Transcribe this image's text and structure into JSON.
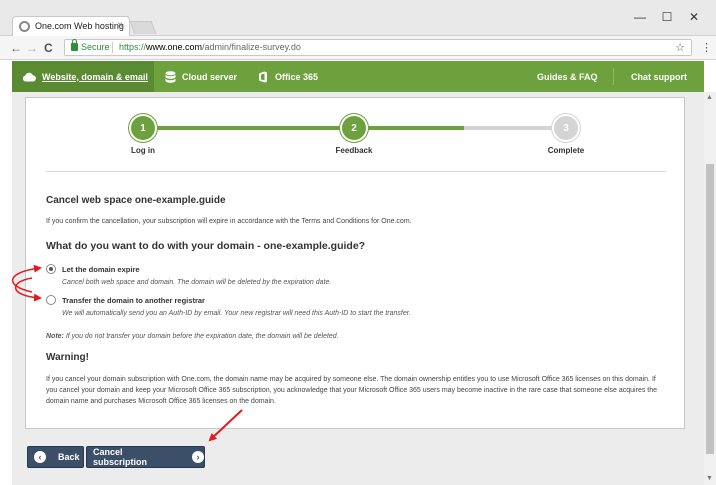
{
  "browser": {
    "tab_title": "One.com Web hosting",
    "tab_close": "×",
    "secure_label": "Secure",
    "url_scheme": "https://",
    "url_host": "www.one.com",
    "url_path": "/admin/finalize-survey.do",
    "window_controls": {
      "minimize": "—",
      "maximize": "☐",
      "close": "✕"
    },
    "nav": {
      "back": "←",
      "forward": "→",
      "reload": "C"
    },
    "star": "☆",
    "menu": "⋮"
  },
  "site_nav": {
    "website_domain_email": "Website, domain & email",
    "cloud_server": "Cloud server",
    "office_365": "Office 365",
    "guides_faq": "Guides & FAQ",
    "chat_support": "Chat support"
  },
  "steps": [
    {
      "number": "1",
      "label": "Log in",
      "state": "done"
    },
    {
      "number": "2",
      "label": "Feedback",
      "state": "current"
    },
    {
      "number": "3",
      "label": "Complete",
      "state": "pending"
    }
  ],
  "colors": {
    "accent_green": "#6da13e",
    "active_nav_green": "#5a8a31",
    "pending_grey": "#d4d4d4",
    "button_navy": "#3b5068",
    "annotation_red": "#e21b1b"
  },
  "cancel_heading": "Cancel web space one-example.guide",
  "cancel_text": "If you confirm the cancellation, your subscription will expire in accordance with the Terms and Conditions for One.com.",
  "domain_question": "What do you want to do with your domain - one-example.guide?",
  "options": [
    {
      "title": "Let the domain expire",
      "description": "Cancel both web space and domain. The domain will be deleted by the expiration date.",
      "selected": true
    },
    {
      "title": "Transfer the domain to another registrar",
      "description": "We will automatically send you an Auth-ID by email. Your new registrar will need this Auth-ID to start the transfer.",
      "selected": false
    }
  ],
  "note": {
    "label": "Note:",
    "text": "If you do not transfer your domain before the expiration date, the domain will be deleted."
  },
  "warning_heading": "Warning!",
  "warning_text": "If you cancel your domain subscription with One.com, the domain name may be acquired by someone else. The domain ownership entitles you to use Microsoft Office 365 licenses on this domain. If you cancel your domain and keep your Microsoft Office 365 subscription, you acknowledge that your Microsoft Office 365 users may become inactive in the rare case that someone else acquires the domain name and purchases Microsoft Office 365 licenses on the domain.",
  "buttons": {
    "back": "Back",
    "back_icon": "‹",
    "cancel_subscription": "Cancel subscription",
    "cancel_icon": "›"
  }
}
